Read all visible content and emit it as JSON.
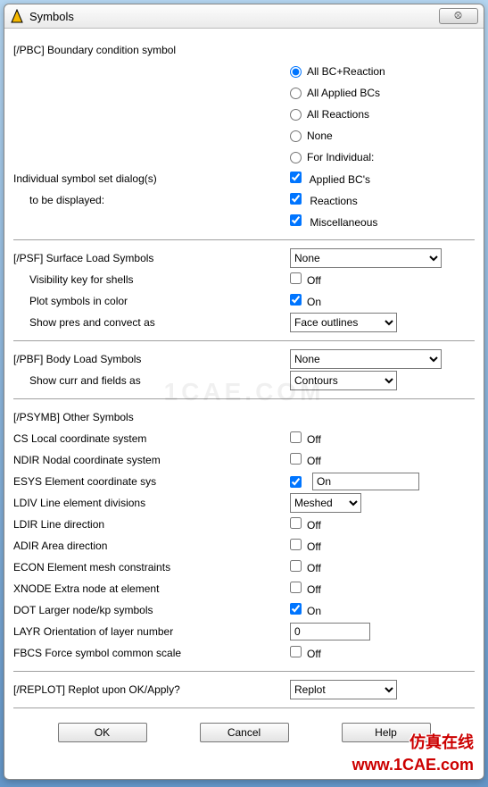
{
  "window": {
    "title": "Symbols",
    "close": "⮾"
  },
  "pbc": {
    "header": "[/PBC] Boundary condition symbol",
    "radios": {
      "all_bc_reaction": "All BC+Reaction",
      "all_applied": "All Applied BCs",
      "all_reactions": "All Reactions",
      "none": "None",
      "for_individual": "For Individual:"
    },
    "selected": "all_bc_reaction",
    "individual_line1": "Individual symbol set dialog(s)",
    "individual_line2": "to be displayed:",
    "checks": {
      "applied_bcs": {
        "label": "Applied BC's",
        "checked": true
      },
      "reactions": {
        "label": "Reactions",
        "checked": true
      },
      "miscellaneous": {
        "label": "Miscellaneous",
        "checked": true
      }
    }
  },
  "psf": {
    "header": "[/PSF]  Surface Load Symbols",
    "value": "None",
    "vis_label": "Visibility key for shells",
    "vis_checked": false,
    "vis_text": "Off",
    "col_label": "Plot symbols in color",
    "col_checked": true,
    "col_text": "On",
    "pres_label": "Show pres and convect as",
    "pres_value": "Face outlines"
  },
  "pbf": {
    "header": "[/PBF]  Body Load Symbols",
    "value": "None",
    "curr_label": "Show curr and fields as",
    "curr_value": "Contours"
  },
  "psymb": {
    "header": "[/PSYMB] Other Symbols",
    "cs": {
      "label": "CS   Local coordinate system",
      "checked": false,
      "text": "Off"
    },
    "ndir": {
      "label": "NDIR Nodal coordinate system",
      "checked": false,
      "text": "Off"
    },
    "esys": {
      "label": "ESYS Element coordinate sys",
      "checked": true,
      "text": "On"
    },
    "ldiv": {
      "label": "LDIV  Line element divisions",
      "value": "Meshed"
    },
    "ldir": {
      "label": "LDIR Line direction",
      "checked": false,
      "text": "Off"
    },
    "adir": {
      "label": "ADIR Area direction",
      "checked": false,
      "text": "Off"
    },
    "econ": {
      "label": "ECON Element mesh constraints",
      "checked": false,
      "text": "Off"
    },
    "xnode": {
      "label": "XNODE Extra node at element",
      "checked": false,
      "text": "Off"
    },
    "dot": {
      "label": "DOT  Larger node/kp symbols",
      "checked": true,
      "text": "On"
    },
    "layr": {
      "label": "LAYR Orientation of layer number",
      "value": "0"
    },
    "fbcs": {
      "label": "FBCS Force symbol common scale",
      "checked": false,
      "text": "Off"
    }
  },
  "replot": {
    "label": "[/REPLOT] Replot upon OK/Apply?",
    "value": "Replot"
  },
  "buttons": {
    "ok": "OK",
    "cancel": "Cancel",
    "help": "Help"
  },
  "watermark": {
    "cn": "仿真在线",
    "en": "www.1CAE.com",
    "mid": "1CAE.COM"
  }
}
